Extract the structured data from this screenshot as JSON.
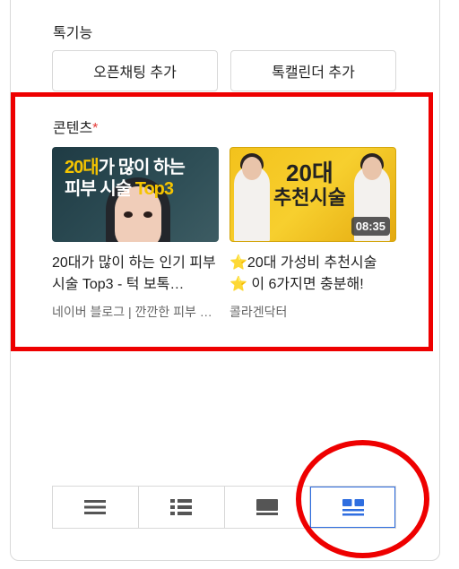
{
  "special_features": {
    "title": "톡기능",
    "buttons": [
      "오픈채팅 추가",
      "톡캘린더 추가"
    ]
  },
  "contents": {
    "title": "콘텐츠",
    "required_mark": "*",
    "cards": [
      {
        "thumb_line1_a": "20대",
        "thumb_line1_b": "가 많이 하는",
        "thumb_line2_a": "피부 시술 ",
        "thumb_line2_b": "Top3",
        "title": "20대가 많이 하는 인기 피부 시술 Top3 - 턱 보톡…",
        "source": "네이버 블로그 | 깐깐한 피부 …"
      },
      {
        "thumb_line1": "20대",
        "thumb_line2": "추천시술",
        "duration": "08:35",
        "title_star1": "⭐",
        "title_part1": "20대 가성비 추천시술",
        "title_star2": "⭐",
        "title_part2": " 이 6가지면 충분해!",
        "source": "콜라겐닥터"
      }
    ]
  },
  "view_modes": [
    {
      "icon": "list-view-icon",
      "active": false
    },
    {
      "icon": "detail-list-view-icon",
      "active": false
    },
    {
      "icon": "large-card-view-icon",
      "active": false
    },
    {
      "icon": "grid-view-icon",
      "active": true
    }
  ],
  "colors": {
    "highlight": "#ee0000",
    "accent": "#2f6ee0",
    "icon_gray": "#555555"
  }
}
